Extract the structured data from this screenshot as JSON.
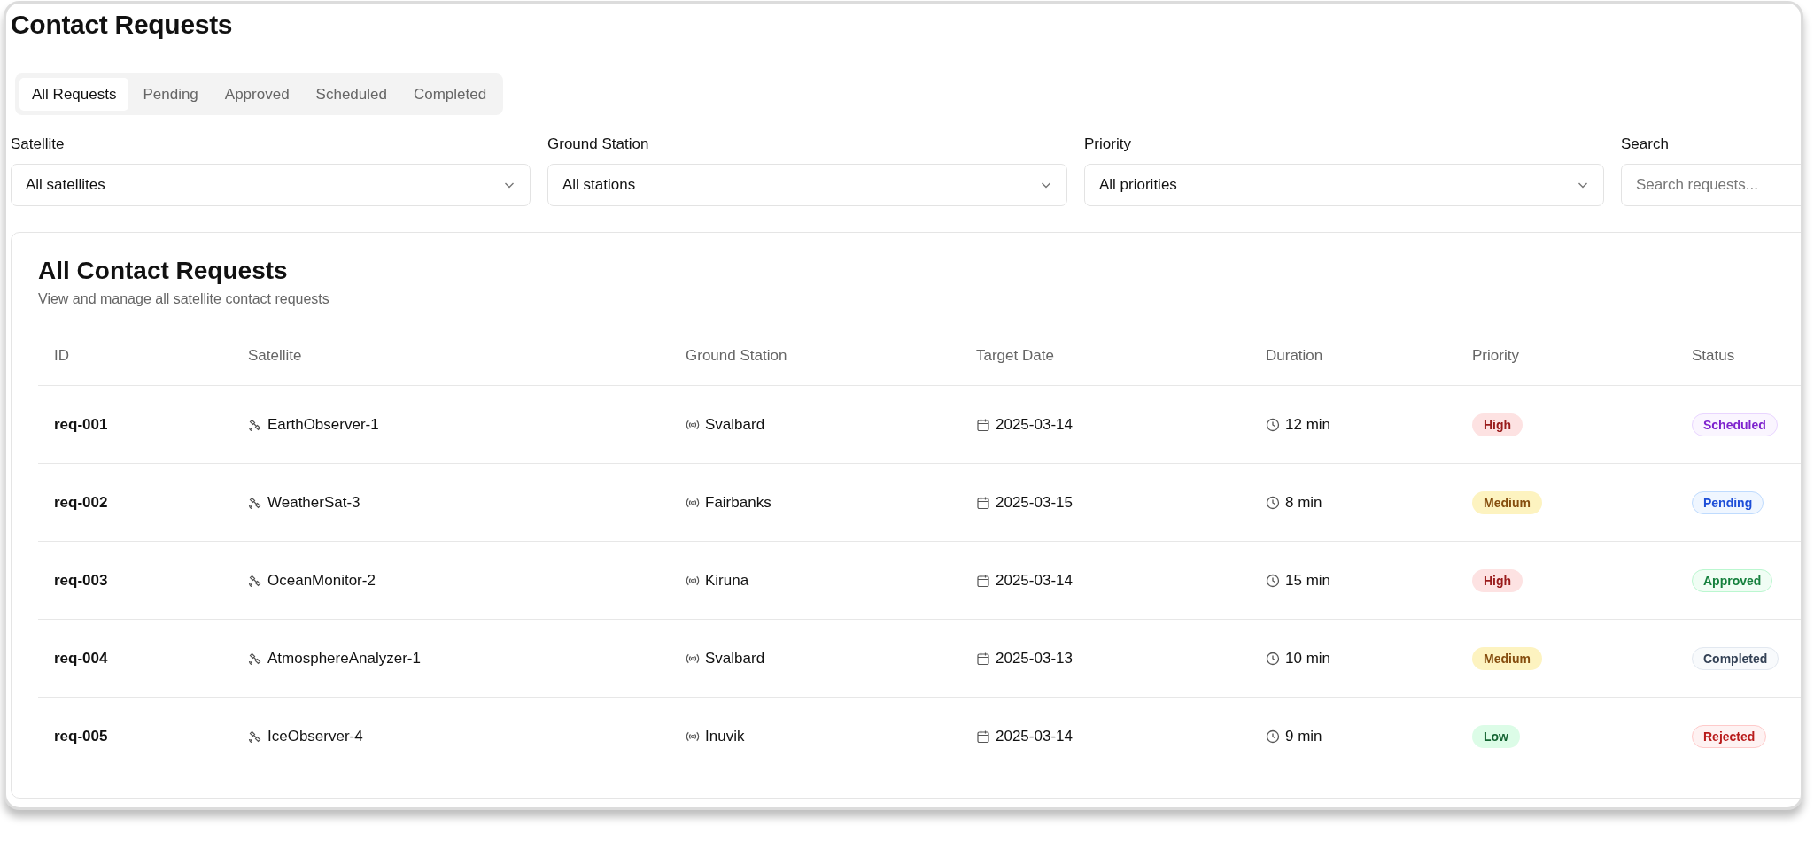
{
  "page": {
    "title": "Contact Requests"
  },
  "tabs": [
    {
      "label": "All Requests",
      "selected": true
    },
    {
      "label": "Pending",
      "selected": false
    },
    {
      "label": "Approved",
      "selected": false
    },
    {
      "label": "Scheduled",
      "selected": false
    },
    {
      "label": "Completed",
      "selected": false
    }
  ],
  "filters": [
    {
      "kind": "select",
      "label": "Satellite",
      "value": "All satellites"
    },
    {
      "kind": "select",
      "label": "Ground Station",
      "value": "All stations"
    },
    {
      "kind": "select",
      "label": "Priority",
      "value": "All priorities"
    },
    {
      "kind": "search",
      "label": "Search",
      "placeholder": "Search requests..."
    }
  ],
  "table": {
    "title": "All Contact Requests",
    "subtitle": "View and manage all satellite contact requests",
    "columns": [
      "ID",
      "Satellite",
      "Ground Station",
      "Target Date",
      "Duration",
      "Priority",
      "Status"
    ],
    "rows": [
      {
        "id": "req-001",
        "satellite": "EarthObserver-1",
        "station": "Svalbard",
        "date": "2025-03-14",
        "duration": "12 min",
        "priority": {
          "label": "High",
          "kind": "high"
        },
        "status": {
          "label": "Scheduled",
          "kind": "scheduled"
        }
      },
      {
        "id": "req-002",
        "satellite": "WeatherSat-3",
        "station": "Fairbanks",
        "date": "2025-03-15",
        "duration": "8 min",
        "priority": {
          "label": "Medium",
          "kind": "medium"
        },
        "status": {
          "label": "Pending",
          "kind": "pending"
        }
      },
      {
        "id": "req-003",
        "satellite": "OceanMonitor-2",
        "station": "Kiruna",
        "date": "2025-03-14",
        "duration": "15 min",
        "priority": {
          "label": "High",
          "kind": "high"
        },
        "status": {
          "label": "Approved",
          "kind": "approved"
        }
      },
      {
        "id": "req-004",
        "satellite": "AtmosphereAnalyzer-1",
        "station": "Svalbard",
        "date": "2025-03-13",
        "duration": "10 min",
        "priority": {
          "label": "Medium",
          "kind": "medium"
        },
        "status": {
          "label": "Completed",
          "kind": "completed"
        }
      },
      {
        "id": "req-005",
        "satellite": "IceObserver-4",
        "station": "Inuvik",
        "date": "2025-03-14",
        "duration": "9 min",
        "priority": {
          "label": "Low",
          "kind": "low"
        },
        "status": {
          "label": "Rejected",
          "kind": "rejected"
        }
      }
    ]
  }
}
